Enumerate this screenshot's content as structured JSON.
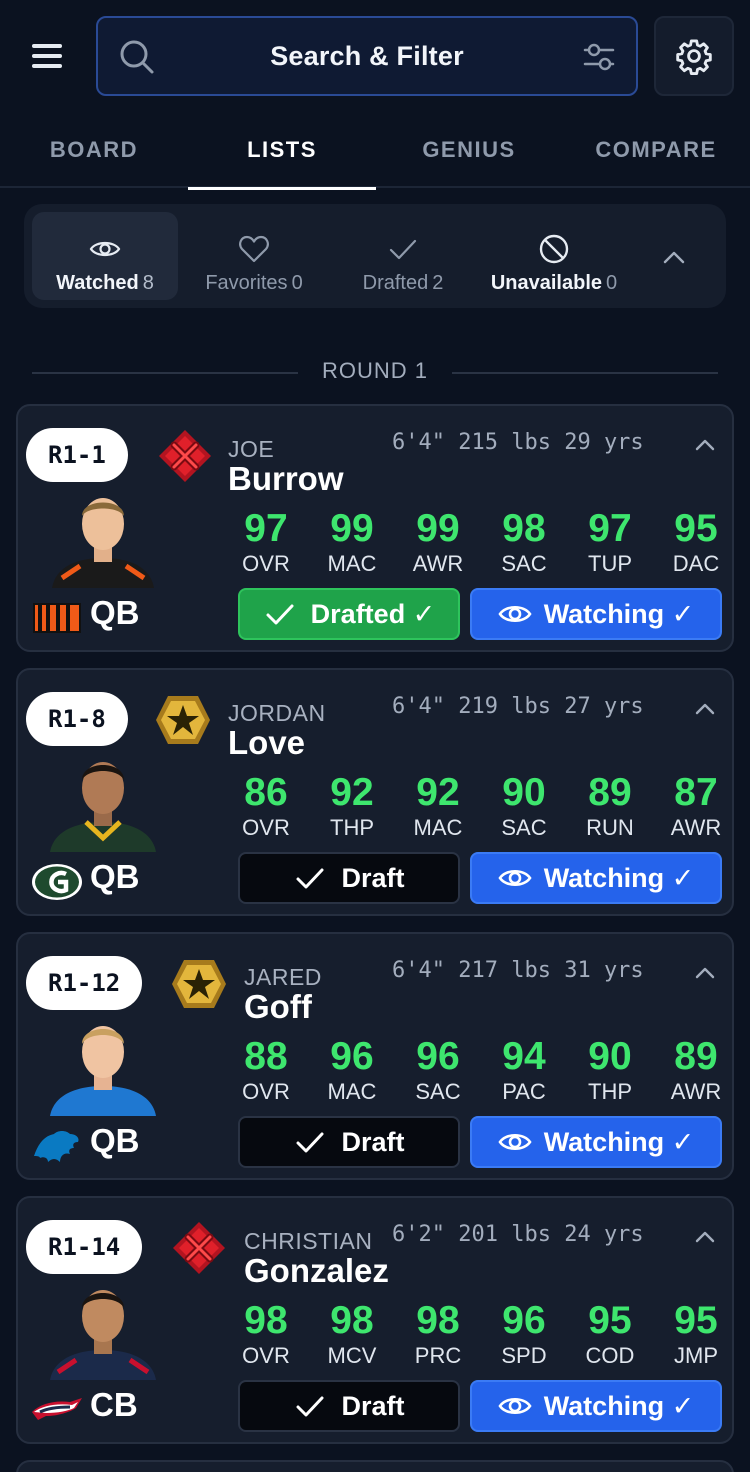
{
  "header": {
    "search_label": "Search & Filter"
  },
  "tabs": [
    {
      "label": "BOARD",
      "active": false
    },
    {
      "label": "LISTS",
      "active": true
    },
    {
      "label": "GENIUS",
      "active": false
    },
    {
      "label": "COMPARE",
      "active": false
    }
  ],
  "lists": [
    {
      "label": "Watched",
      "count": "8",
      "icon": "eye-icon",
      "active": true
    },
    {
      "label": "Favorites",
      "count": "0",
      "icon": "heart-icon",
      "active": false
    },
    {
      "label": "Drafted",
      "count": "2",
      "icon": "check-icon",
      "active": false
    },
    {
      "label": "Unavailable",
      "count": "0",
      "icon": "ban-icon",
      "active": false
    }
  ],
  "round_label": "ROUND 1",
  "players": [
    {
      "pick": "R1-1",
      "tier": "x-tier-icon",
      "first": "JOE",
      "last": "Burrow",
      "height": "6'4\"",
      "weight": "215 lbs",
      "age": "29 yrs",
      "position": "QB",
      "team": "bengals-logo",
      "stats": [
        {
          "v": "97",
          "l": "OVR"
        },
        {
          "v": "99",
          "l": "MAC"
        },
        {
          "v": "99",
          "l": "AWR"
        },
        {
          "v": "98",
          "l": "SAC"
        },
        {
          "v": "97",
          "l": "TUP"
        },
        {
          "v": "95",
          "l": "DAC"
        }
      ],
      "draft_label": "Drafted ✓",
      "draft_done": true,
      "watch_label": "Watching ✓"
    },
    {
      "pick": "R1-8",
      "tier": "star-tier-icon",
      "first": "JORDAN",
      "last": "Love",
      "height": "6'4\"",
      "weight": "219 lbs",
      "age": "27 yrs",
      "position": "QB",
      "team": "packers-logo",
      "stats": [
        {
          "v": "86",
          "l": "OVR"
        },
        {
          "v": "92",
          "l": "THP"
        },
        {
          "v": "92",
          "l": "MAC"
        },
        {
          "v": "90",
          "l": "SAC"
        },
        {
          "v": "89",
          "l": "RUN"
        },
        {
          "v": "87",
          "l": "AWR"
        }
      ],
      "draft_label": "Draft",
      "draft_done": false,
      "watch_label": "Watching ✓"
    },
    {
      "pick": "R1-12",
      "tier": "star-tier-icon",
      "first": "JARED",
      "last": "Goff",
      "height": "6'4\"",
      "weight": "217 lbs",
      "age": "31 yrs",
      "position": "QB",
      "team": "lions-logo",
      "stats": [
        {
          "v": "88",
          "l": "OVR"
        },
        {
          "v": "96",
          "l": "MAC"
        },
        {
          "v": "96",
          "l": "SAC"
        },
        {
          "v": "94",
          "l": "PAC"
        },
        {
          "v": "90",
          "l": "THP"
        },
        {
          "v": "89",
          "l": "AWR"
        }
      ],
      "draft_label": "Draft",
      "draft_done": false,
      "watch_label": "Watching ✓"
    },
    {
      "pick": "R1-14",
      "tier": "x-tier-icon",
      "first": "CHRISTIAN",
      "last": "Gonzalez",
      "height": "6'2\"",
      "weight": "201 lbs",
      "age": "24 yrs",
      "position": "CB",
      "team": "patriots-logo",
      "stats": [
        {
          "v": "98",
          "l": "OVR"
        },
        {
          "v": "98",
          "l": "MCV"
        },
        {
          "v": "98",
          "l": "PRC"
        },
        {
          "v": "96",
          "l": "SPD"
        },
        {
          "v": "95",
          "l": "COD"
        },
        {
          "v": "95",
          "l": "JMP"
        }
      ],
      "draft_label": "Draft",
      "draft_done": false,
      "watch_label": "Watching ✓"
    }
  ],
  "colors": {
    "accent_blue": "#2563eb",
    "drafted_green": "#1fa34a",
    "stat_green": "#3ee66e",
    "tier_red": "#e0202a",
    "tier_gold": "#e3b63c"
  }
}
